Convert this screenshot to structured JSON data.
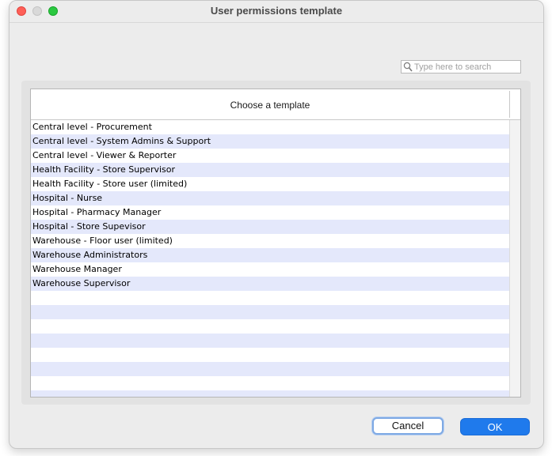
{
  "window": {
    "title": "User permissions template"
  },
  "search": {
    "placeholder": "Type here to search",
    "value": ""
  },
  "table": {
    "header": "Choose a template",
    "rows": [
      "Central level - Procurement",
      "Central level - System Admins & Support",
      "Central level - Viewer & Reporter",
      "Health Facility - Store Supervisor",
      "Health Facility - Store user (limited)",
      "Hospital - Nurse",
      "Hospital - Pharmacy Manager",
      "Hospital - Store Supevisor",
      "Warehouse - Floor user (limited)",
      "Warehouse Administrators",
      "Warehouse Manager",
      "Warehouse Supervisor",
      "",
      "",
      "",
      "",
      "",
      "",
      "",
      ""
    ]
  },
  "buttons": {
    "cancel": "Cancel",
    "ok": "OK"
  },
  "colors": {
    "accent": "#1f7aec",
    "row_stripe": "#e4e8fb",
    "close": "#fe5f57",
    "maximize": "#2ac840"
  },
  "icons": {
    "search": "magnifier-icon"
  }
}
